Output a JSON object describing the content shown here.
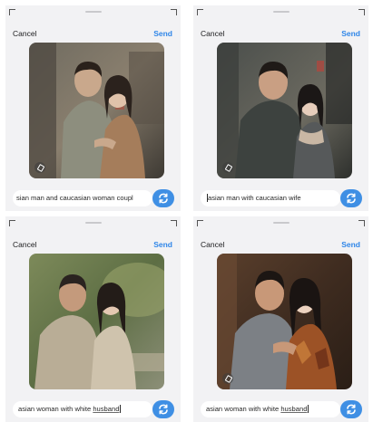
{
  "panels": [
    {
      "cancel_label": "Cancel",
      "send_label": "Send",
      "prompt_text": "sian man and caucasian woman coupl",
      "icons": [
        "ai-sparkle-icon",
        "refresh-icon"
      ]
    },
    {
      "cancel_label": "Cancel",
      "send_label": "Send",
      "prompt_pre": "",
      "prompt_text": "asian man with caucasian wife",
      "icons": [
        "ai-sparkle-icon",
        "refresh-icon"
      ]
    },
    {
      "cancel_label": "Cancel",
      "send_label": "Send",
      "prompt_text": "asian woman with white ",
      "prompt_underlined": "husband",
      "icons": [
        "refresh-icon"
      ]
    },
    {
      "cancel_label": "Cancel",
      "send_label": "Send",
      "prompt_text": "asian woman with white ",
      "prompt_underlined": "husband",
      "icons": [
        "ai-sparkle-icon",
        "refresh-icon"
      ]
    }
  ],
  "colors": {
    "accent": "#2f86e8",
    "button": "#3f8fe4",
    "panel_bg": "#f2f2f4"
  }
}
